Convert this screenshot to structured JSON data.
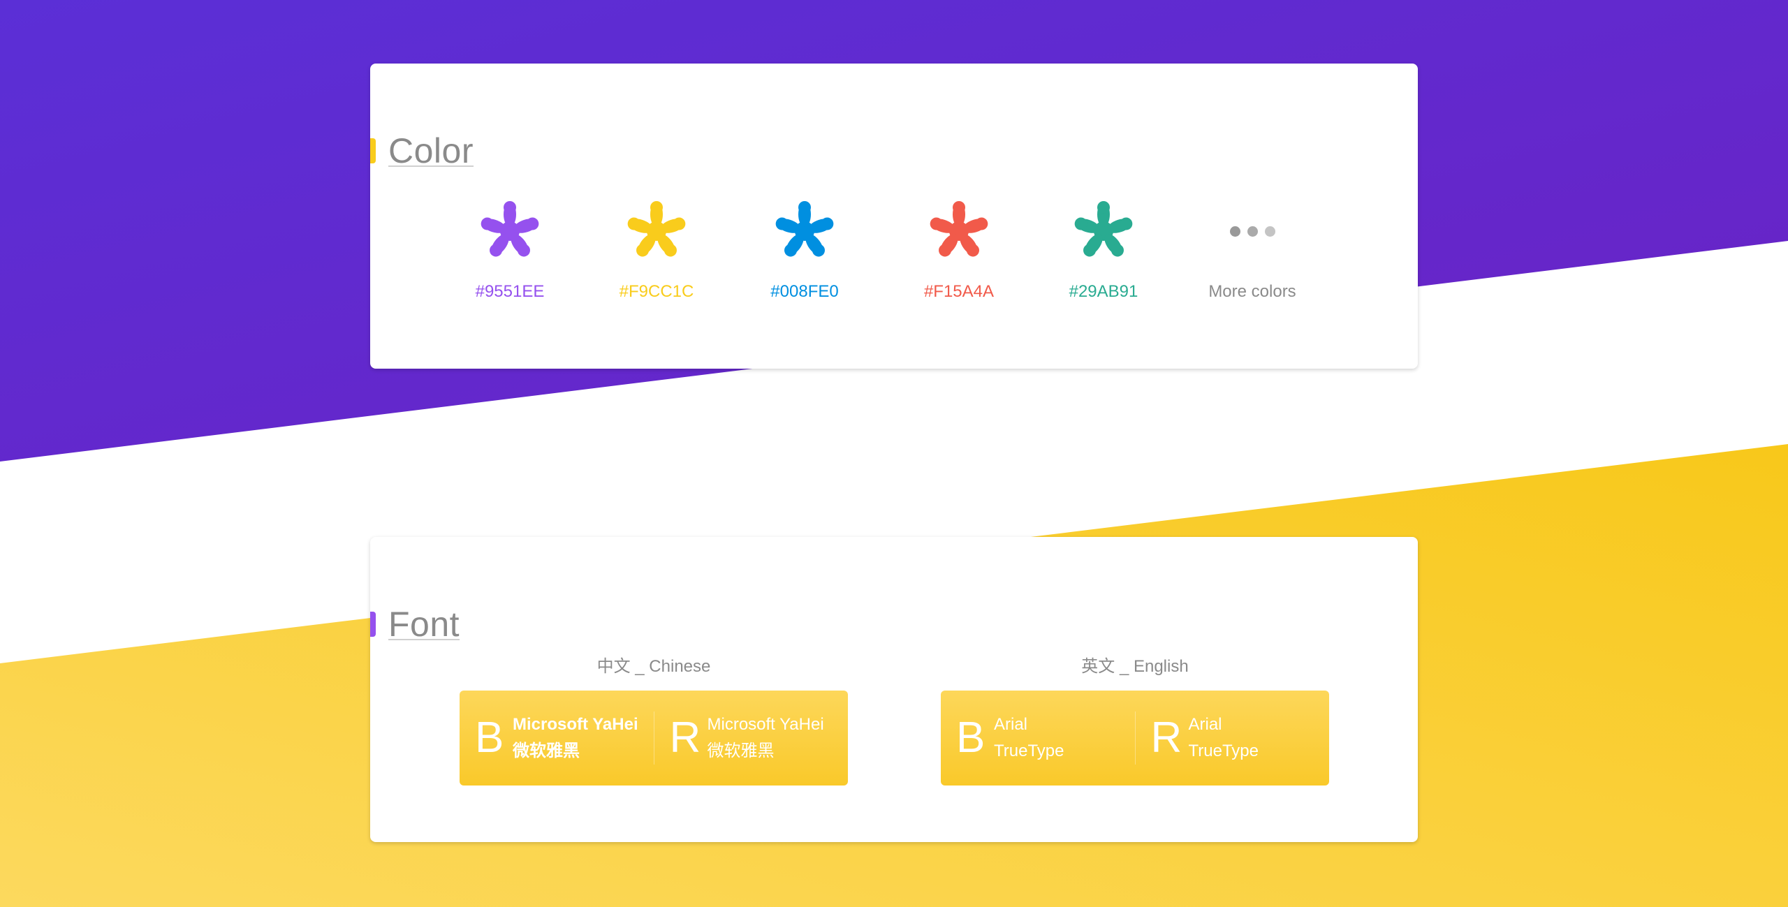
{
  "colors": {
    "purple": "#9551EE",
    "yellow": "#F9CC1C",
    "blue": "#008FE0",
    "red": "#F15A4A",
    "green": "#29AB91",
    "more_dots": [
      "#999999",
      "#aaaaaa",
      "#c4c4c4"
    ]
  },
  "color_section": {
    "title": "Color",
    "accent": "#F9CC1C",
    "swatches": [
      {
        "label": "#9551EE",
        "color": "#9551EE",
        "icon": "flower-icon"
      },
      {
        "label": "#F9CC1C",
        "color": "#F9CC1C",
        "icon": "flower-icon"
      },
      {
        "label": "#008FE0",
        "color": "#008FE0",
        "icon": "flower-icon"
      },
      {
        "label": "#F15A4A",
        "color": "#F15A4A",
        "icon": "flower-icon"
      },
      {
        "label": "#29AB91",
        "color": "#29AB91",
        "icon": "flower-icon"
      }
    ],
    "more": {
      "label": "More colors",
      "icon": "more-dots-icon"
    }
  },
  "font_section": {
    "title": "Font",
    "accent": "#9551EE",
    "chinese": {
      "label": "中文 _ Chinese",
      "bold": {
        "letter": "B",
        "name": "Microsoft YaHei",
        "cn": "微软雅黑"
      },
      "regular": {
        "letter": "R",
        "name": "Microsoft YaHei",
        "cn": "微软雅黑"
      }
    },
    "english": {
      "label": "英文 _ English",
      "bold": {
        "letter": "B",
        "name": "Arial",
        "type": "TrueType"
      },
      "regular": {
        "letter": "R",
        "name": "Arial",
        "type": "TrueType"
      }
    }
  }
}
